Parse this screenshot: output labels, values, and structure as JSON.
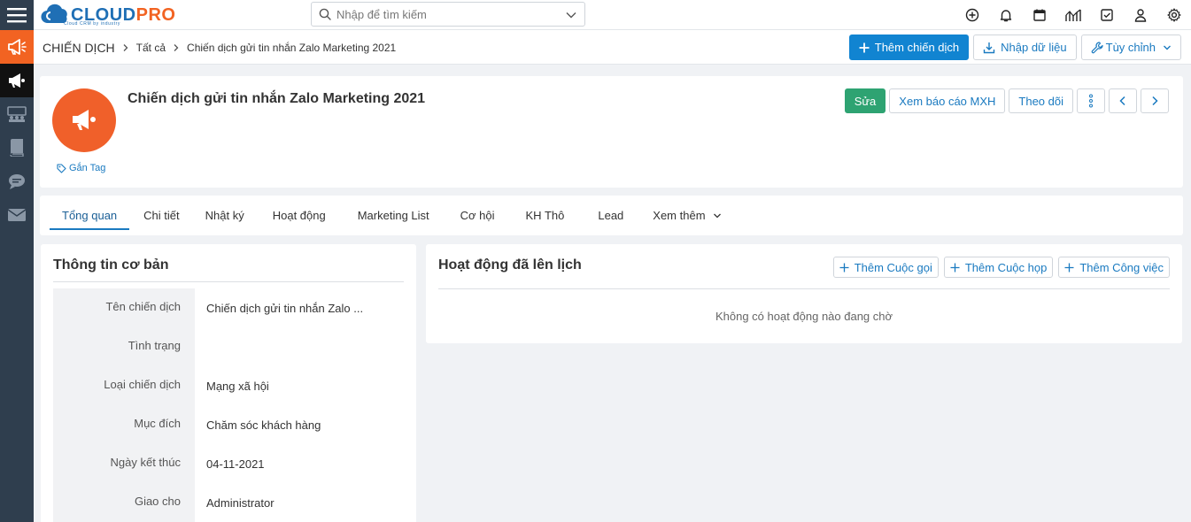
{
  "app": {
    "logo_main": "CLOUD",
    "logo_accent": "PRO",
    "logo_tagline": "Cloud CRM by industry"
  },
  "search": {
    "placeholder": "Nhập để tìm kiếm"
  },
  "top_icons": [
    "add-circle-icon",
    "bell-icon",
    "calendar-icon",
    "chart-icon",
    "checkbox-icon",
    "user-icon",
    "gear-icon"
  ],
  "rail_icons": [
    "menu-icon",
    "megaphone-icon",
    "campaign-icon",
    "group-icon",
    "book-icon",
    "chat-icon",
    "mail-icon"
  ],
  "breadcrumb": {
    "module": "CHIẾN DỊCH",
    "items": [
      "Tất cả",
      "Chiến dịch gửi tin nhắn Zalo Marketing 2021"
    ]
  },
  "toolbar": {
    "add_label": "Thêm chiến dịch",
    "import_label": "Nhập dữ liệu",
    "customize_label": "Tùy chỉnh"
  },
  "record": {
    "title": "Chiến dịch gửi tin nhắn Zalo Marketing 2021",
    "tag_label": "Gắn Tag",
    "edit_label": "Sửa",
    "report_label": "Xem báo cáo MXH",
    "follow_label": "Theo dõi"
  },
  "tabs": [
    {
      "label": "Tổng quan",
      "active": true
    },
    {
      "label": "Chi tiết",
      "active": false
    },
    {
      "label": "Nhật ký",
      "active": false
    },
    {
      "label": "Hoạt động",
      "active": false
    },
    {
      "label": "Marketing List",
      "active": false
    },
    {
      "label": "Cơ hội",
      "active": false
    },
    {
      "label": "KH Thô",
      "active": false
    },
    {
      "label": "Lead",
      "active": false
    },
    {
      "label": "Xem thêm",
      "active": false
    }
  ],
  "basic_info": {
    "title": "Thông tin cơ bản",
    "fields": [
      {
        "label": "Tên chiến dịch",
        "value": "Chiến dịch gửi tin nhắn Zalo ..."
      },
      {
        "label": "Tình trạng",
        "value": ""
      },
      {
        "label": "Loại chiến dịch",
        "value": "Mạng xã hội"
      },
      {
        "label": "Mục đích",
        "value": "Chăm sóc khách hàng"
      },
      {
        "label": "Ngày kết thúc",
        "value": "04-11-2021"
      },
      {
        "label": "Giao cho",
        "value": "Administrator"
      }
    ]
  },
  "activities": {
    "title": "Hoạt động đã lên lịch",
    "add_call": "Thêm Cuộc gọi",
    "add_meeting": "Thêm Cuộc họp",
    "add_task": "Thêm Công việc",
    "empty_text": "Không có hoạt động nào đang chờ"
  },
  "colors": {
    "brand_orange": "#f26322",
    "brand_blue": "#1f6fb5",
    "primary_button": "#1184d1",
    "edit_button": "#2ea372",
    "rail_bg": "#2f3e4e"
  }
}
